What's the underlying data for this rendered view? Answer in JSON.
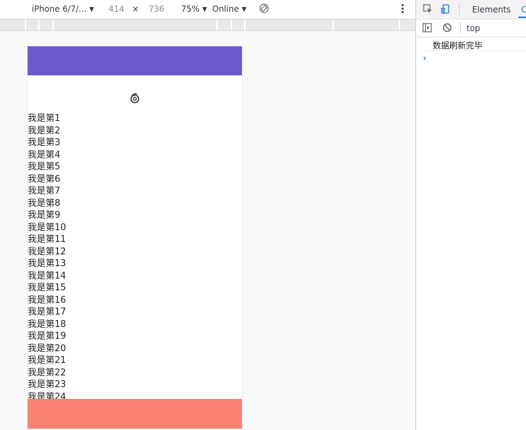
{
  "device_toolbar": {
    "device": "iPhone 6/7/...",
    "width": "414",
    "times": "×",
    "height": "736",
    "zoom": "75%",
    "network": "Online"
  },
  "phone": {
    "header_color": "#6a5acd",
    "footer_color": "#fa8072",
    "list_items": [
      "我是第1",
      "我是第2",
      "我是第3",
      "我是第4",
      "我是第5",
      "我是第6",
      "我是第7",
      "我是第8",
      "我是第9",
      "我是第10",
      "我是第11",
      "我是第12",
      "我是第13",
      "我是第14",
      "我是第15",
      "我是第16",
      "我是第17",
      "我是第18",
      "我是第19",
      "我是第20",
      "我是第21",
      "我是第22",
      "我是第23",
      "我是第24"
    ]
  },
  "devtools": {
    "tabs": [
      "Elements",
      "C"
    ],
    "context": "top",
    "console_messages": [
      "数据刷新完毕"
    ],
    "prompt": "›"
  }
}
